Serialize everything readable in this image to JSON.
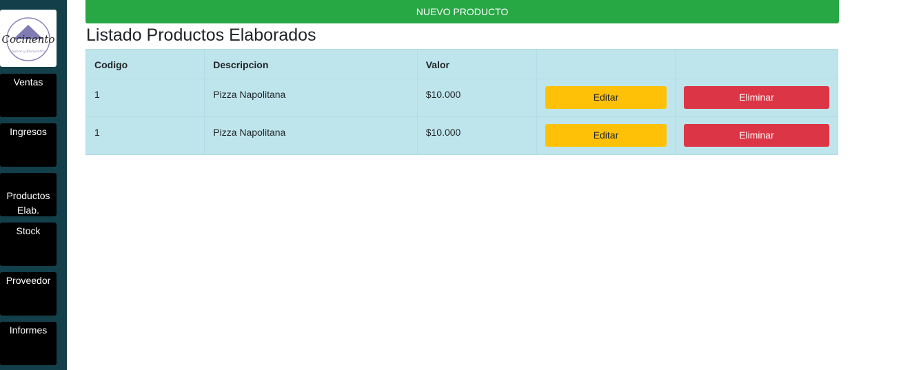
{
  "brand": {
    "logo_text": "Cocinento",
    "logo_tagline": "Sabor y Encuentro"
  },
  "sidebar": {
    "items": [
      {
        "label": "Ventas"
      },
      {
        "label": "Ingresos"
      },
      {
        "label": "Productos Elab."
      },
      {
        "label": "Stock"
      },
      {
        "label": "Proveedor"
      },
      {
        "label": "Informes"
      }
    ]
  },
  "toolbar": {
    "new_product_label": "NUEVO PRODUCTO"
  },
  "page": {
    "title": "Listado Productos Elaborados"
  },
  "table": {
    "columns": [
      "Codigo",
      "Descripcion",
      "Valor",
      "",
      ""
    ],
    "rows": [
      {
        "codigo": "1",
        "descripcion": "Pizza Napolitana",
        "valor": "$10.000",
        "edit_label": "Editar",
        "delete_label": "Eliminar"
      },
      {
        "codigo": "1",
        "descripcion": "Pizza Napolitana",
        "valor": "$10.000",
        "edit_label": "Editar",
        "delete_label": "Eliminar"
      }
    ]
  },
  "colors": {
    "sidebar_bg": "#123f4a",
    "success": "#28a745",
    "warning": "#ffc107",
    "danger": "#dc3545",
    "table_info": "#bee5eb"
  }
}
